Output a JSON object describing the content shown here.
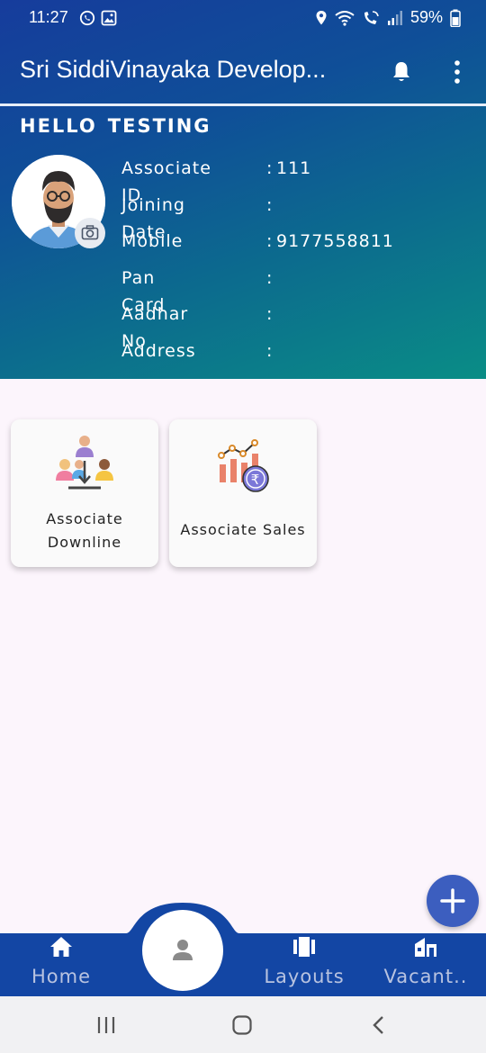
{
  "status_bar": {
    "time": "11:27",
    "battery": "59%"
  },
  "app_bar": {
    "title": "Sri SiddiVinayaka Develop...",
    "icons": [
      "notification-bell-icon",
      "more-vert-icon"
    ]
  },
  "profile": {
    "greeting_word": "HELLO",
    "user_name": "TESTING",
    "fields": [
      {
        "label": "Associate ID",
        "value": "111"
      },
      {
        "label": "Joining Date",
        "value": ""
      },
      {
        "label": "Mobile",
        "value": "9177558811"
      },
      {
        "label": "Pan Card",
        "value": ""
      },
      {
        "label": "Aadhar No",
        "value": ""
      },
      {
        "label": "Address",
        "value": ""
      }
    ],
    "separator": ":"
  },
  "cards": [
    {
      "line1": "Associate",
      "line2": "Downline",
      "icon": "team-hierarchy-icon"
    },
    {
      "label": "Associate Sales",
      "icon": "sales-chart-rupee-icon"
    }
  ],
  "bottom_nav": {
    "items": [
      {
        "label": "Home",
        "icon": "home-icon"
      },
      {
        "label": "Layouts",
        "icon": "layouts-icon"
      },
      {
        "label": "Vacant..",
        "icon": "vacant-plots-icon"
      }
    ],
    "center_icon": "profile-icon"
  },
  "colors": {
    "header_start": "#163c9c",
    "header_end": "#0a8d86",
    "nav_bg": "#1346a4",
    "fab": "#3c5ebf",
    "background": "#fcf5fc"
  }
}
